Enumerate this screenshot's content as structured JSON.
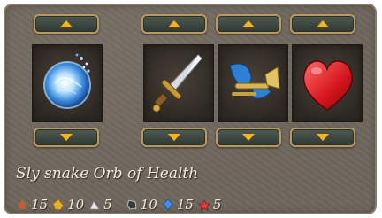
{
  "item": {
    "name": "Sly snake Orb of Health"
  },
  "slots": [
    {
      "id": "orb",
      "icon": "magic-orb-icon"
    },
    {
      "id": "weapon",
      "icon": "dagger-icon"
    },
    {
      "id": "trumpet",
      "icon": "blue-trumpet-icon"
    },
    {
      "id": "heart",
      "icon": "red-heart-icon"
    }
  ],
  "stats": [
    {
      "icon": "flame-pile-icon",
      "color": "#c0602e",
      "value": "15"
    },
    {
      "icon": "yellow-gem-icon",
      "color": "#e2b22d",
      "value": "10"
    },
    {
      "icon": "white-shard-icon",
      "color": "#e6e6e6",
      "value": "5"
    },
    {
      "icon": "dark-crystal-icon",
      "color": "#d8d8d8",
      "value": "10"
    },
    {
      "icon": "blue-gem-icon",
      "color": "#3f8fe6",
      "value": "15"
    },
    {
      "icon": "red-gem-icon",
      "color": "#e03a3a",
      "value": "5"
    }
  ],
  "colors": {
    "panel": "#6f665c",
    "button_border": "#b79a5d",
    "arrow": "#f0b526",
    "text": "#f2ead8"
  }
}
